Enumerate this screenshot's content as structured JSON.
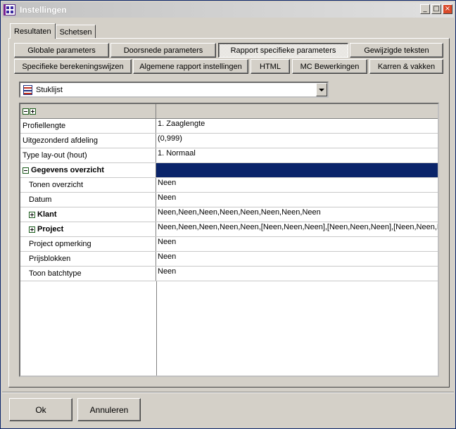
{
  "window": {
    "title": "Instellingen"
  },
  "tabs": [
    {
      "label": "Resultaten",
      "active": true
    },
    {
      "label": "Schetsen",
      "active": false
    }
  ],
  "button_row1": [
    "Globale parameters",
    "Doorsnede parameters",
    "Rapport specifieke parameters",
    "Gewijzigde teksten"
  ],
  "button_row2": [
    "Specifieke berekeningswijzen",
    "Algemene rapport instellingen",
    "HTML",
    "MC Bewerkingen",
    "Karren & vakken"
  ],
  "selected_button": "Rapport specifieke parameters",
  "report_select": {
    "value": "Stuklijst"
  },
  "grid": {
    "rows": [
      {
        "label": "Profiellengte",
        "value": "1. Zaaglengte"
      },
      {
        "label": "Uitgezonderd afdeling",
        "value": "(0,999)"
      },
      {
        "label": "Type lay-out (hout)",
        "value": "1. Normaal"
      },
      {
        "label": "Gegevens overzicht",
        "value": ""
      },
      {
        "label": "Tonen overzicht",
        "value": "Neen"
      },
      {
        "label": "Datum",
        "value": "Neen"
      },
      {
        "label": "Klant",
        "value": "Neen,Neen,Neen,Neen,Neen,Neen,Neen,Neen"
      },
      {
        "label": "Project",
        "value": "Neen,Neen,Neen,Neen,Neen,[Neen,Neen,Neen],[Neen,Neen,Neen],[Neen,Neen,Neen]"
      },
      {
        "label": "Project opmerking",
        "value": "Neen"
      },
      {
        "label": "Prijsblokken",
        "value": "Neen"
      },
      {
        "label": "Toon batchtype",
        "value": "Neen"
      }
    ]
  },
  "footer": {
    "ok_label": "Ok",
    "cancel_label": "Annuleren"
  }
}
